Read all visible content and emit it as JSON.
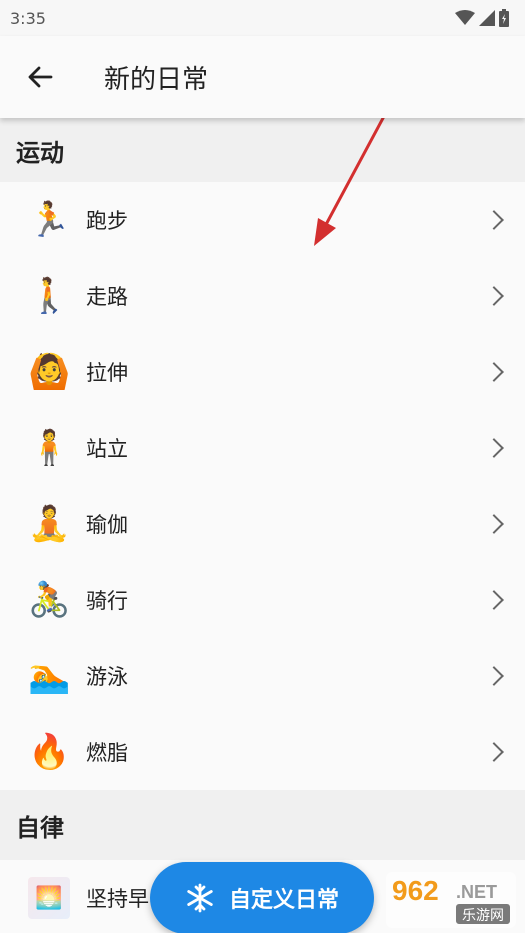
{
  "status_bar": {
    "time": "3:35"
  },
  "app_bar": {
    "title": "新的日常"
  },
  "sections": [
    {
      "title": "运动",
      "items": [
        {
          "label": "跑步",
          "emoji": "🏃"
        },
        {
          "label": "走路",
          "emoji": "🚶"
        },
        {
          "label": "拉伸",
          "emoji": "🙆"
        },
        {
          "label": "站立",
          "emoji": "🧍"
        },
        {
          "label": "瑜伽",
          "emoji": "🧘"
        },
        {
          "label": "骑行",
          "emoji": "🚴"
        },
        {
          "label": "游泳",
          "emoji": "🏊"
        },
        {
          "label": "燃脂",
          "emoji": "🔥"
        }
      ]
    },
    {
      "title": "自律",
      "items": [
        {
          "label": "坚持早",
          "icon": "app-thumbnail-icon"
        }
      ]
    }
  ],
  "fab": {
    "label": "自定义日常",
    "icon": "snowflake-icon"
  },
  "watermark": {
    "text_top": "962",
    "text_top_suffix": ".NET",
    "text_bottom": "乐游网"
  },
  "colors": {
    "fab": "#1e88e5",
    "annotation_arrow": "#d32f2f"
  }
}
